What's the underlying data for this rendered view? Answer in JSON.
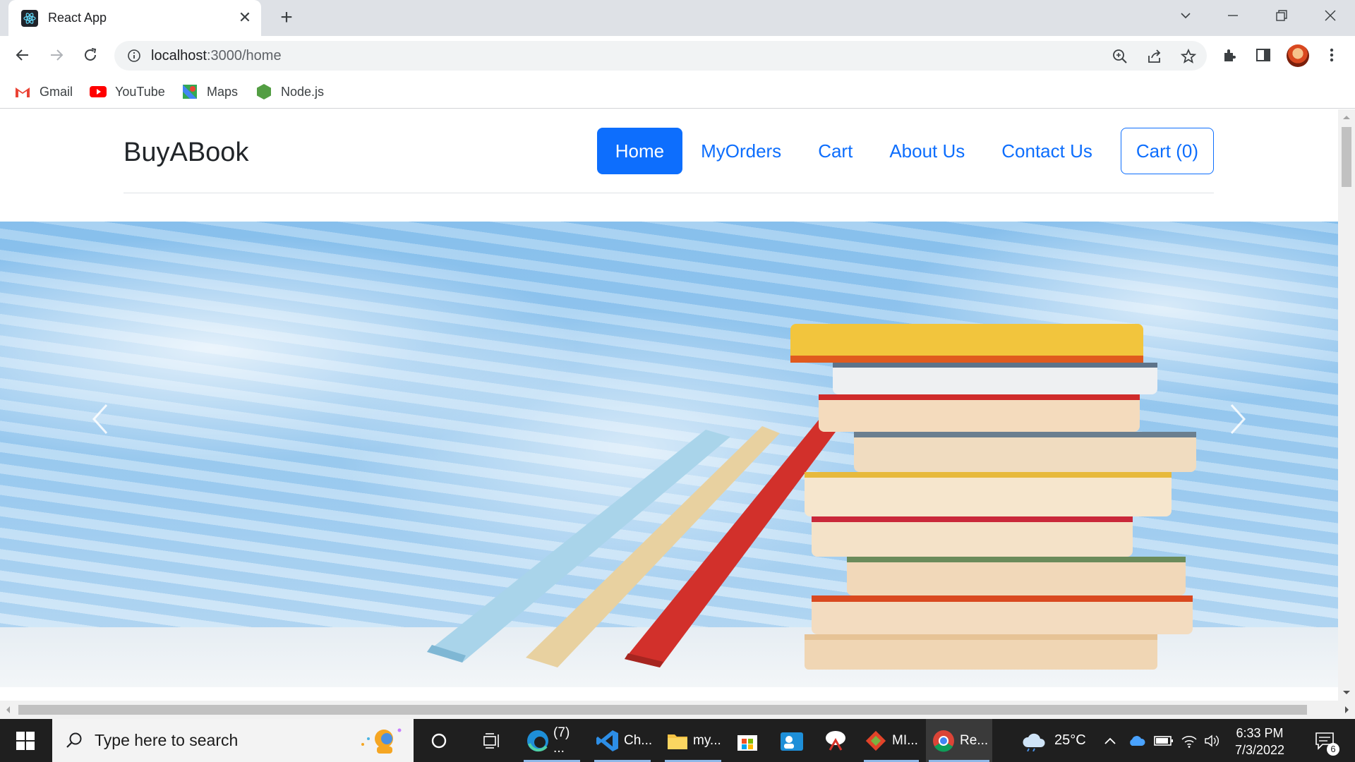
{
  "browser": {
    "tab_title": "React App",
    "url_host": "localhost",
    "url_path": ":3000/home",
    "bookmarks": [
      {
        "label": "Gmail",
        "icon": "gmail-icon"
      },
      {
        "label": "YouTube",
        "icon": "youtube-icon"
      },
      {
        "label": "Maps",
        "icon": "maps-icon"
      },
      {
        "label": "Node.js",
        "icon": "nodejs-icon"
      }
    ]
  },
  "site": {
    "brand": "BuyABook",
    "nav": [
      {
        "label": "Home",
        "active": true
      },
      {
        "label": "MyOrders",
        "active": false
      },
      {
        "label": "Cart",
        "active": false
      },
      {
        "label": "About Us",
        "active": false
      },
      {
        "label": "Contact Us",
        "active": false
      }
    ],
    "cart_button": "Cart (0)",
    "accent_color": "#0d6efd"
  },
  "taskbar": {
    "search_placeholder": "Type here to search",
    "apps": [
      {
        "label": "(7) ...",
        "icon": "edge-icon"
      },
      {
        "label": "Ch...",
        "icon": "vscode-icon"
      },
      {
        "label": "my...",
        "icon": "folder-icon"
      },
      {
        "label": "",
        "icon": "store-icon"
      },
      {
        "label": "",
        "icon": "people-icon"
      },
      {
        "label": "",
        "icon": "snipping-icon"
      },
      {
        "label": "MI...",
        "icon": "git-icon"
      },
      {
        "label": "Re...",
        "icon": "chrome-icon"
      }
    ],
    "weather": "25°C",
    "time": "6:33 PM",
    "date": "7/3/2022",
    "notifications": "6"
  }
}
